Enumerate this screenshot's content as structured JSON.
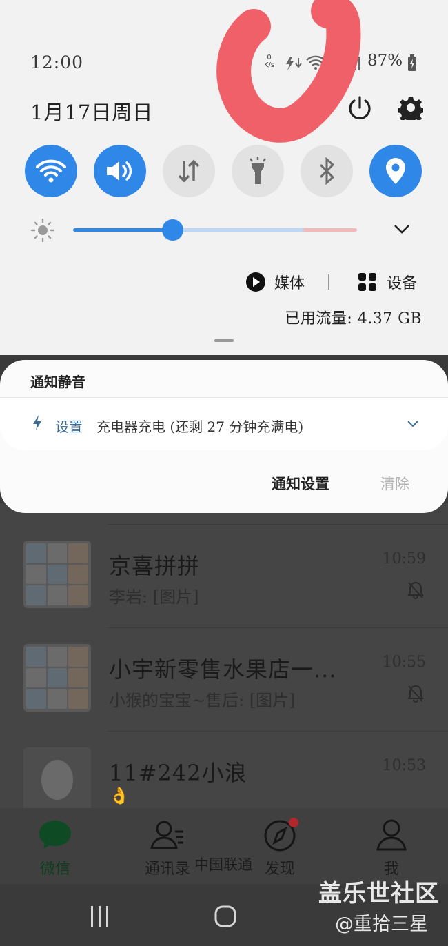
{
  "shade": {
    "time": "12:00",
    "date": "1月17日周日",
    "net_speed_value": "0",
    "net_speed_unit": "K/s",
    "battery": "87%",
    "quick_toggles": [
      {
        "name": "wifi",
        "on": true
      },
      {
        "name": "sound",
        "on": true
      },
      {
        "name": "mobile-data",
        "on": false
      },
      {
        "name": "flashlight",
        "on": false
      },
      {
        "name": "bluetooth",
        "on": false
      },
      {
        "name": "location",
        "on": true
      }
    ],
    "brightness_level": 0.35,
    "media_label": "媒体",
    "devices_label": "设备",
    "data_usage": "已用流量: 4.37 GB"
  },
  "notification": {
    "header": "通知静音",
    "app": "设置",
    "text": "充电器充电 (还剩 27 分钟充满电)",
    "settings_label": "通知设置",
    "clear_label": "清除"
  },
  "chats": [
    {
      "name": "京喜拼拼",
      "message": "李岩: [图片]",
      "time": "10:59",
      "muted": true
    },
    {
      "name": "小宇新零售水果店一...",
      "message": "小猴的宝宝~售后: [图片]",
      "time": "10:55",
      "muted": true
    },
    {
      "name": "11#242小浪",
      "message": "👌",
      "time": "10:53",
      "muted": false
    }
  ],
  "tabs": [
    {
      "label": "微信",
      "icon": "chat-bubble-icon",
      "active": true
    },
    {
      "label": "通讯录",
      "icon": "contacts-icon",
      "active": false
    },
    {
      "label": "发现",
      "icon": "compass-icon",
      "active": false,
      "badge": true
    },
    {
      "label": "我",
      "icon": "person-icon",
      "active": false
    }
  ],
  "carrier": "中国联通",
  "watermark": {
    "line1": "盖乐世社区",
    "line2": "@重拾三星"
  },
  "colors": {
    "accent": "#2f87e8",
    "scribble": "#ef5b63"
  }
}
